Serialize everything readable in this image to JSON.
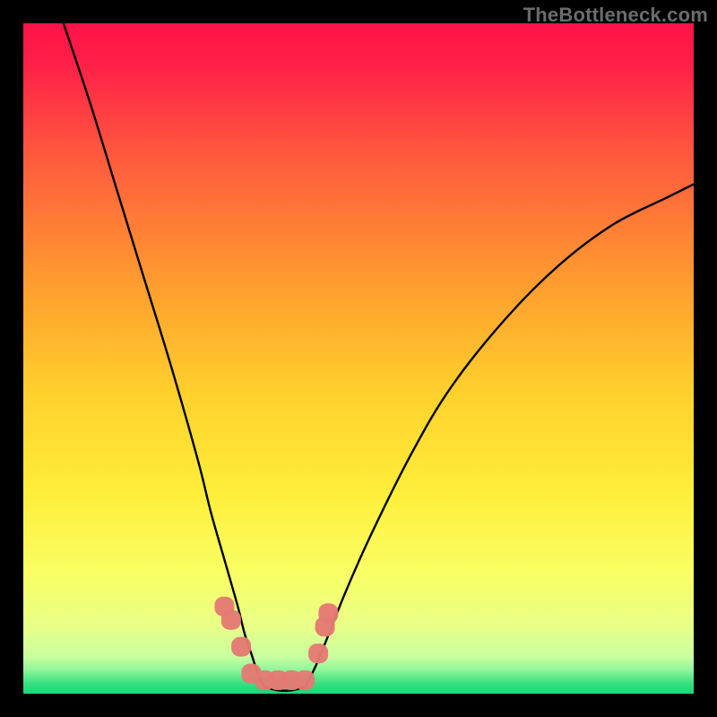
{
  "watermark": "TheBottleneck.com",
  "chart_data": {
    "type": "line",
    "title": "",
    "xlabel": "",
    "ylabel": "",
    "xlim": [
      0,
      100
    ],
    "ylim": [
      0,
      100
    ],
    "grid": false,
    "legend": false,
    "background_gradient": {
      "top_color": "#ff1846",
      "mid_top_color": "#ff8c2e",
      "mid_color": "#ffe338",
      "mid_bottom_color": "#f6ff66",
      "bottom_color": "#18e07a"
    },
    "series": [
      {
        "name": "left-curve",
        "color": "#000000",
        "x": [
          6,
          10,
          14,
          18,
          22,
          26,
          28,
          30,
          32,
          33,
          34,
          35,
          36
        ],
        "y": [
          100,
          88,
          75,
          62,
          49,
          35,
          27,
          20,
          13,
          9,
          6,
          3,
          1
        ]
      },
      {
        "name": "right-curve",
        "color": "#000000",
        "x": [
          42,
          44,
          48,
          52,
          58,
          64,
          72,
          80,
          88,
          96,
          100
        ],
        "y": [
          1,
          5,
          15,
          24,
          36,
          46,
          56,
          64,
          70,
          74,
          76
        ]
      },
      {
        "name": "valley-floor",
        "color": "#000000",
        "x": [
          36,
          38,
          40,
          42
        ],
        "y": [
          1,
          0.5,
          0.5,
          1
        ]
      }
    ],
    "markers": [
      {
        "name": "marker-cluster",
        "color": "#e47a74",
        "shape": "rounded-square",
        "size": 22,
        "points": [
          {
            "x": 30,
            "y": 13
          },
          {
            "x": 31,
            "y": 11
          },
          {
            "x": 32.5,
            "y": 7
          },
          {
            "x": 34,
            "y": 3
          },
          {
            "x": 36,
            "y": 2
          },
          {
            "x": 38,
            "y": 2
          },
          {
            "x": 40,
            "y": 2
          },
          {
            "x": 42,
            "y": 2
          },
          {
            "x": 44,
            "y": 6
          },
          {
            "x": 45,
            "y": 10
          },
          {
            "x": 45.5,
            "y": 12
          }
        ]
      }
    ]
  }
}
